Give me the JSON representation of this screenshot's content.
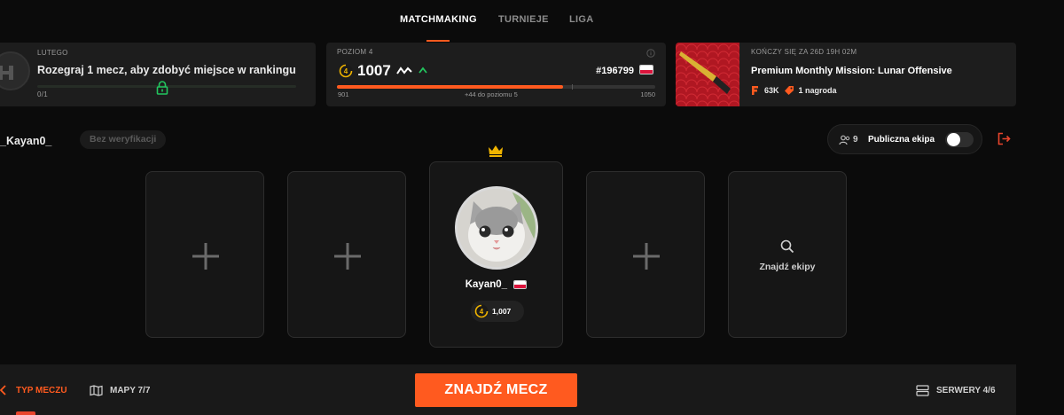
{
  "nav": {
    "tabs": [
      "MATCHMAKING",
      "TURNIEJE",
      "LIGA"
    ],
    "active": "MATCHMAKING"
  },
  "ranking_card": {
    "period_label": "LUTEGO",
    "text": "Rozegraj 1 mecz, aby zdobyć miejsce w rankingu",
    "progress_text": "0/1",
    "progress": 0.0
  },
  "level_card": {
    "level_label": "POZIOM 4",
    "level": "4",
    "elo": "1007",
    "rank": "#196799",
    "min": "901",
    "max": "1050",
    "to_next": "+44 do poziomu 5",
    "progress": 0.71
  },
  "mission_card": {
    "ends_label": "KOŃCZY SIĘ ZA 26D 19H 02M",
    "title": "Premium Monthly Mission: Lunar Offensive",
    "points": "63K",
    "reward": "1 nagroda"
  },
  "party": {
    "username": "_Kayan0_",
    "verification": "Bez weryfikacji",
    "member_count": "9",
    "public_label": "Publiczna ekipa",
    "public_enabled": false
  },
  "player": {
    "name": "Kayan0_",
    "level": "4",
    "elo": "1,007"
  },
  "find_team_label": "Znajdź ekipy",
  "bottom": {
    "match_type": "TYP MECZU",
    "maps": "MAPY 7/7",
    "find_match": "ZNAJDŹ MECZ",
    "servers": "SERWERY 4/6"
  },
  "colors": {
    "accent": "#ff5a1f",
    "progress_green": "#22c55e",
    "mission_red": "#b01722"
  }
}
